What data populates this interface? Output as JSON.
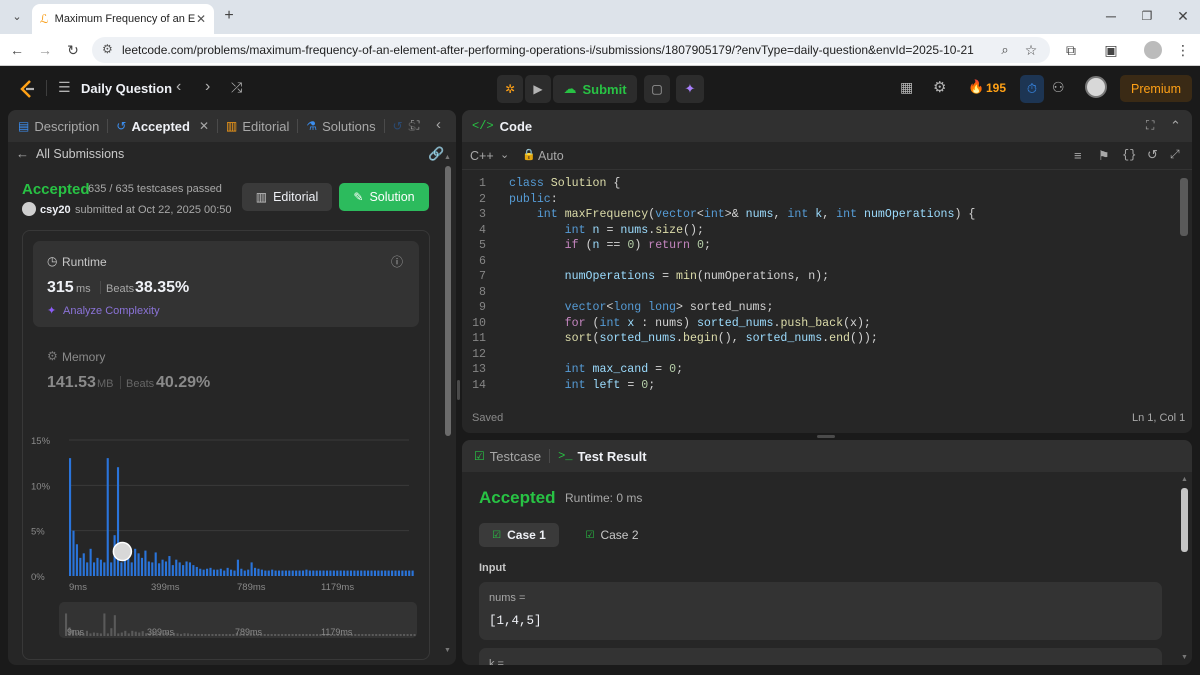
{
  "browser": {
    "tab_title": "Maximum Frequency of an Elem",
    "url": "leetcode.com/problems/maximum-frequency-of-an-element-after-performing-operations-i/submissions/1807905179/?envType=daily-question&envId=2025-10-21"
  },
  "nav": {
    "daily_label": "Daily Question",
    "submit_label": "Submit",
    "streak_count": "195",
    "premium_label": "Premium"
  },
  "left_panel": {
    "tabs": {
      "description": "Description",
      "accepted": "Accepted",
      "editorial": "Editorial",
      "solutions": "Solutions",
      "submissions": "S"
    },
    "back_label": "All Submissions",
    "status": "Accepted",
    "testcases": "635 / 635 testcases passed",
    "user": "csy20",
    "submitted_text": "submitted at Oct 22, 2025 00:50",
    "editorial_btn": "Editorial",
    "solution_btn": "Solution",
    "runtime": {
      "label": "Runtime",
      "value": "315",
      "unit": "ms",
      "beats_label": "Beats",
      "beats_value": "38.35%",
      "analyze": "Analyze Complexity"
    },
    "memory": {
      "label": "Memory",
      "value": "141.53",
      "unit": "MB",
      "beats_label": "Beats",
      "beats_value": "40.29%"
    }
  },
  "chart_data": {
    "type": "bar",
    "ylim": [
      0,
      15
    ],
    "y_ticks": [
      "15%",
      "10%",
      "5%",
      "0%"
    ],
    "x_ticks": [
      "9ms",
      "399ms",
      "789ms",
      "1179ms"
    ],
    "values": [
      13,
      5,
      3.5,
      2,
      2.5,
      1.5,
      3,
      1.5,
      2,
      1.8,
      1.5,
      13,
      1.5,
      4.5,
      12,
      1.5,
      2,
      3,
      1.5,
      3,
      2.5,
      2,
      2.8,
      1.6,
      1.5,
      2.6,
      1.4,
      1.8,
      1.6,
      2.2,
      1.2,
      1.8,
      1.5,
      1.2,
      1.6,
      1.5,
      1.2,
      1,
      0.8,
      0.7,
      0.8,
      0.9,
      0.7,
      0.7,
      0.8,
      0.6,
      0.9,
      0.7,
      0.6,
      1.8,
      0.8,
      0.6,
      0.7,
      1.5,
      0.9,
      0.8,
      0.7,
      0.6,
      0.6,
      0.7,
      0.6,
      0.6,
      0.6,
      0.6,
      0.6,
      0.6,
      0.6,
      0.6,
      0.6,
      0.7,
      0.6,
      0.6,
      0.6,
      0.6,
      0.6,
      0.6,
      0.6,
      0.6,
      0.6,
      0.6,
      0.6,
      0.6,
      0.6,
      0.6,
      0.6,
      0.6,
      0.6,
      0.6,
      0.6,
      0.6,
      0.6,
      0.6,
      0.6,
      0.6,
      0.6,
      0.6,
      0.6,
      0.6,
      0.6,
      0.6,
      0.6
    ],
    "bar_color": "#2a74da"
  },
  "code_panel": {
    "title": "Code",
    "language": "C++",
    "auto": "Auto",
    "saved": "Saved",
    "cursor": "Ln 1, Col 1",
    "line_numbers": [
      "1",
      "2",
      "3",
      "4",
      "5",
      "6",
      "7",
      "8",
      "9",
      "10",
      "11",
      "12",
      "13",
      "14"
    ]
  },
  "result_panel": {
    "testcase_tab": "Testcase",
    "result_tab": "Test Result",
    "status": "Accepted",
    "runtime": "Runtime: 0 ms",
    "case1": "Case 1",
    "case2": "Case 2",
    "input_label": "Input",
    "nums_label": "nums =",
    "nums_value": "[1,4,5]",
    "k_label": "k ="
  }
}
